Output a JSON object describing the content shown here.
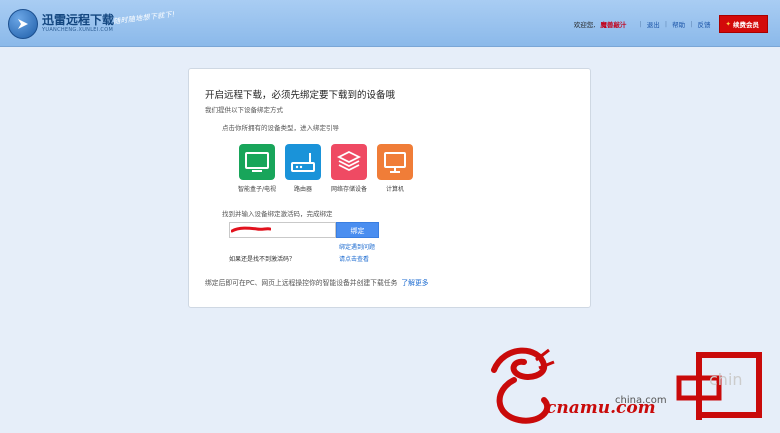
{
  "header": {
    "app_title": "迅雷远程下载",
    "app_subtitle": "YUANCHENG.XUNLEI.COM",
    "slogan": "随时随地想下就下!",
    "welcome": "欢迎您,",
    "username": "魔兽敲汁",
    "links": [
      "退出",
      "帮助",
      "反馈"
    ],
    "vip_label": "续费会员"
  },
  "card": {
    "title": "开启远程下载，必须先绑定要下载到的设备哦",
    "subtitle": "我们提供以下设备绑定方式",
    "step1": "点击你所拥有的设备类型，进入绑定引导",
    "devices": [
      {
        "label": "智能盒子/电视",
        "color": "#18a55a",
        "icon": "tv-icon"
      },
      {
        "label": "路由器",
        "color": "#1a93d9",
        "icon": "router-icon"
      },
      {
        "label": "网络存储设备",
        "color": "#ef4a63",
        "icon": "storage-icon"
      },
      {
        "label": "计算机",
        "color": "#f07d38",
        "icon": "computer-icon"
      }
    ],
    "step2": "找到并输入设备绑定激活码，完成绑定",
    "code_value": "",
    "bind_label": "绑定",
    "help_link": "绑定遇到问题",
    "no_code": "如果还是找不到激活码？",
    "click_link": "请点击查看",
    "footer_note": "绑定后即可在PC、网页上远程操控你的智能设备并创建下载任务",
    "learn_more": "了解更多"
  },
  "watermark": {
    "text": "cnamu.com",
    "site": "china.com"
  }
}
